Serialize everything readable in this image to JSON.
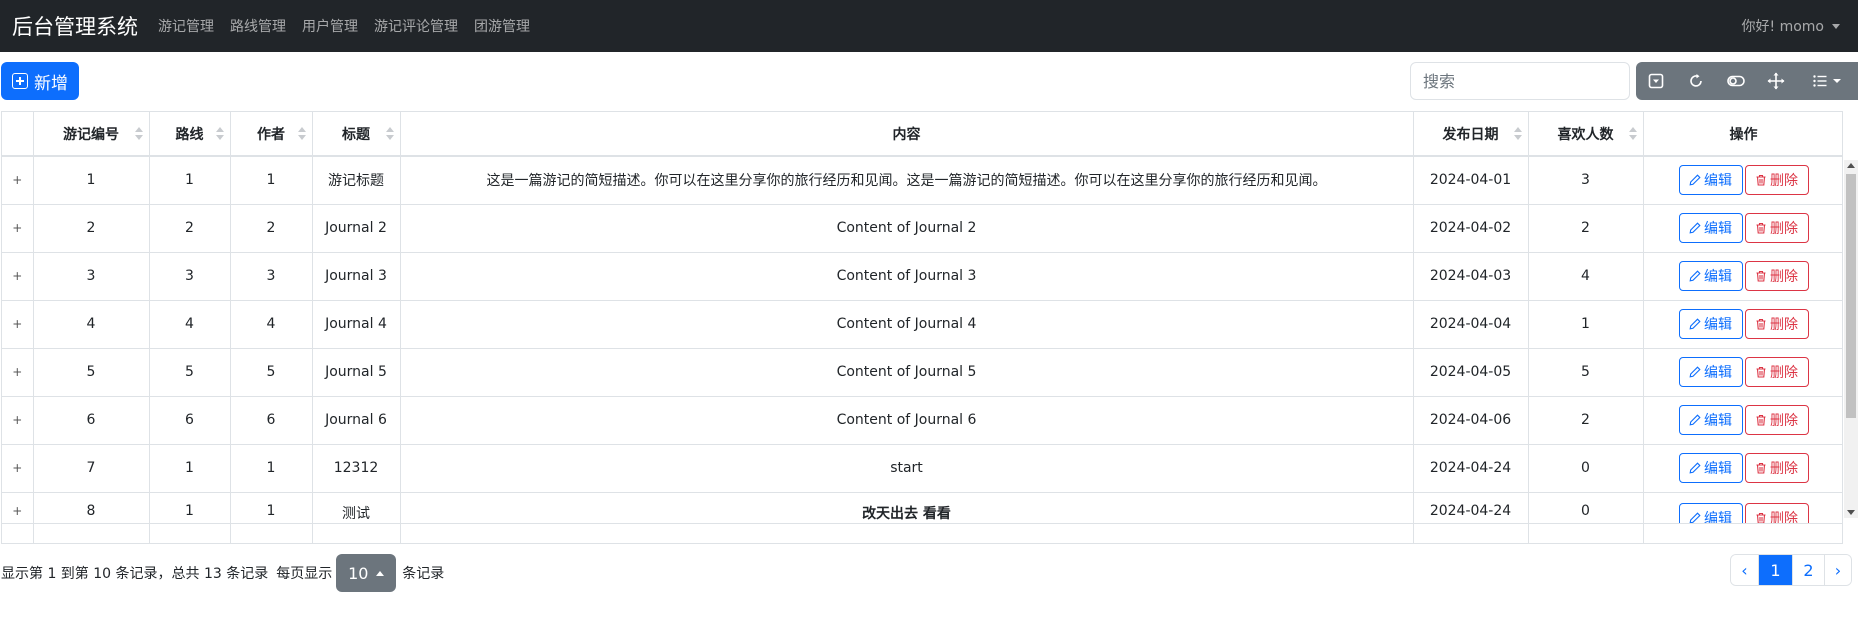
{
  "navbar": {
    "brand": "后台管理系统",
    "links": [
      "游记管理",
      "路线管理",
      "用户管理",
      "游记评论管理",
      "团游管理"
    ],
    "user": "你好! momo"
  },
  "toolbar": {
    "add_label": "新增",
    "search_placeholder": "搜索",
    "icons": [
      "export-icon",
      "refresh-icon",
      "toggle-icon",
      "fullscreen-icon",
      "columns-icon"
    ]
  },
  "table": {
    "columns": [
      "",
      "游记编号",
      "路线",
      "作者",
      "标题",
      "内容",
      "发布日期",
      "喜欢人数",
      "操作"
    ],
    "edit_label": "编辑",
    "delete_label": "删除",
    "rows": [
      {
        "id": "1",
        "route": "1",
        "author": "1",
        "title": "游记标题",
        "content": "这是一篇游记的简短描述。你可以在这里分享你的旅行经历和见闻。这是一篇游记的简短描述。你可以在这里分享你的旅行经历和见闻。",
        "date": "2024-04-01",
        "likes": "3"
      },
      {
        "id": "2",
        "route": "2",
        "author": "2",
        "title": "Journal 2",
        "content": "Content of Journal 2",
        "date": "2024-04-02",
        "likes": "2"
      },
      {
        "id": "3",
        "route": "3",
        "author": "3",
        "title": "Journal 3",
        "content": "Content of Journal 3",
        "date": "2024-04-03",
        "likes": "4"
      },
      {
        "id": "4",
        "route": "4",
        "author": "4",
        "title": "Journal 4",
        "content": "Content of Journal 4",
        "date": "2024-04-04",
        "likes": "1"
      },
      {
        "id": "5",
        "route": "5",
        "author": "5",
        "title": "Journal 5",
        "content": "Content of Journal 5",
        "date": "2024-04-05",
        "likes": "5"
      },
      {
        "id": "6",
        "route": "6",
        "author": "6",
        "title": "Journal 6",
        "content": "Content of Journal 6",
        "date": "2024-04-06",
        "likes": "2"
      },
      {
        "id": "7",
        "route": "1",
        "author": "1",
        "title": "12312",
        "content": "start",
        "date": "2024-04-24",
        "likes": "0"
      },
      {
        "id": "8",
        "route": "1",
        "author": "1",
        "title": "测试",
        "content": "改天出去 看看",
        "date": "2024-04-24",
        "likes": "0"
      }
    ]
  },
  "footer": {
    "info_before": "显示第 1 到第 10 条记录，总共 13 条记录",
    "per_page_label": "每页显示",
    "page_size": "10",
    "info_after": "条记录",
    "pages": [
      "‹",
      "1",
      "2",
      "›"
    ],
    "active_page": "1"
  },
  "colors": {
    "primary": "#0d6efd",
    "danger": "#dc3545",
    "secondary": "#6c757d",
    "navbar": "#212529"
  }
}
